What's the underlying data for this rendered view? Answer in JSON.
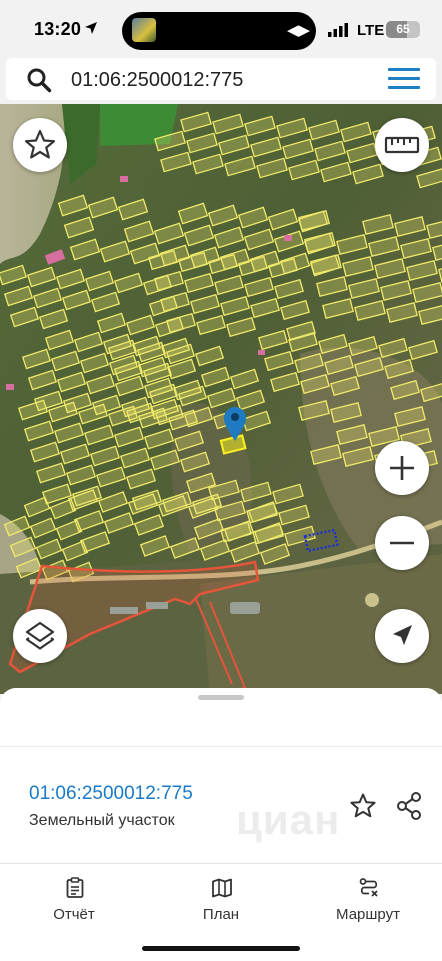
{
  "status_bar": {
    "time": "13:20",
    "network": "LTE",
    "battery": "65"
  },
  "search": {
    "query": "01:06:2500012:775",
    "icons": [
      "search-icon",
      "menu-icon"
    ]
  },
  "map": {
    "colors": {
      "parcel_outline": "#f0ea6a",
      "selected_parcel": "#f5ec1e",
      "zone_outline": "#e4553a",
      "pin": "#1f7ac2",
      "dotted_parcel": "#1b2fd6"
    },
    "controls": [
      "star-icon",
      "ruler-icon",
      "zoom-in-icon",
      "zoom-out-icon",
      "layers-icon",
      "navigation-arrow-icon"
    ]
  },
  "sheet": {
    "cadastral_number": "01:06:2500012:775",
    "object_type": "Земельный участок",
    "watermark": "циан",
    "icons": [
      "star-outline-icon",
      "share-icon"
    ]
  },
  "tabs": [
    {
      "label": "Отчёт",
      "icon": "report-icon"
    },
    {
      "label": "План",
      "icon": "map-plan-icon"
    },
    {
      "label": "Маршрут",
      "icon": "route-icon"
    }
  ]
}
